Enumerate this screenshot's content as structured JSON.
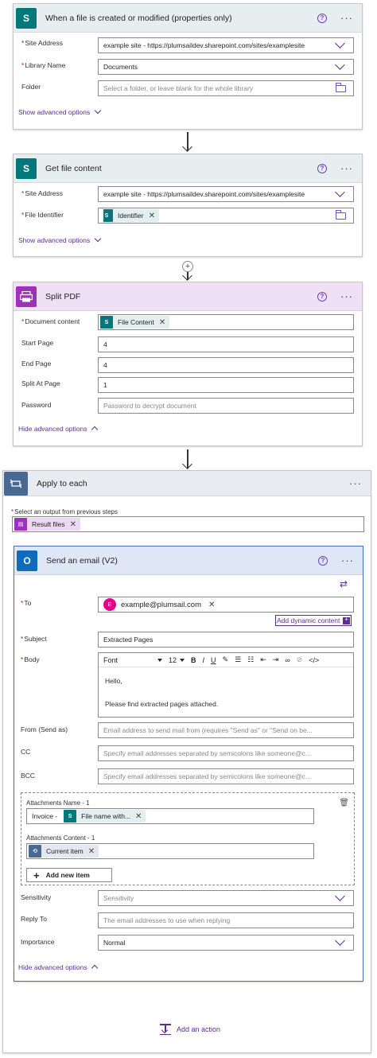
{
  "trigger": {
    "title": "When a file is created or modified (properties only)",
    "icon": "sharepoint-icon",
    "icon_letter": "S",
    "site_address_label": "Site Address",
    "site_address_value": "example site - https://plumsaildev.sharepoint.com/sites/examplesite",
    "library_name_label": "Library Name",
    "library_name_value": "Documents",
    "folder_label": "Folder",
    "folder_placeholder": "Select a folder, or leave blank for the whole library",
    "advanced_link": "Show advanced options"
  },
  "get_file": {
    "title": "Get file content",
    "icon": "sharepoint-icon",
    "icon_letter": "S",
    "site_address_label": "Site Address",
    "site_address_value": "example site - https://plumsaildev.sharepoint.com/sites/examplesite",
    "file_identifier_label": "File Identifier",
    "file_identifier_token": "Identifier",
    "advanced_link": "Show advanced options"
  },
  "split_pdf": {
    "title": "Split PDF",
    "icon": "pdf-icon",
    "document_content_label": "Document content",
    "document_content_token": "File Content",
    "start_page_label": "Start Page",
    "start_page_value": "4",
    "end_page_label": "End Page",
    "end_page_value": "4",
    "split_at_page_label": "Split At Page",
    "split_at_page_value": "1",
    "password_label": "Password",
    "password_placeholder": "Password to decrypt document",
    "advanced_link": "Hide advanced options"
  },
  "apply_each": {
    "title": "Apply to each",
    "icon": "loop-icon",
    "select_label": "Select an output from previous steps",
    "select_token": "Result files"
  },
  "send_email": {
    "title": "Send an email (V2)",
    "icon": "outlook-icon",
    "icon_letter": "O",
    "to_label": "To",
    "to_avatar": "E",
    "to_value": "example@plumsail.com",
    "dynamic_content_label": "Add dynamic content",
    "subject_label": "Subject",
    "subject_value": "Extracted Pages",
    "body_label": "Body",
    "body_font": "Font",
    "body_size": "12",
    "body_line1": "Hello,",
    "body_line2": "Please find extracted pages attached.",
    "from_label": "From (Send as)",
    "from_placeholder": "Email address to send mail from (requires \"Send as\" or \"Send on be...",
    "cc_label": "CC",
    "cc_placeholder": "Specify email addresses separated by semicolons like someone@c...",
    "bcc_label": "BCC",
    "bcc_placeholder": "Specify email addresses separated by semicolons like someone@c...",
    "att_name_label": "Attachments Name - 1",
    "att_name_prefix": "Invoice -",
    "att_name_token": "File name with...",
    "att_content_label": "Attachments Content - 1",
    "att_content_token": "Current item",
    "add_item_label": "Add new item",
    "sensitivity_label": "Sensitivity",
    "sensitivity_placeholder": "Sensitivity",
    "reply_to_label": "Reply To",
    "reply_to_placeholder": "The email addresses to use when replying",
    "importance_label": "Importance",
    "importance_value": "Normal",
    "advanced_link": "Hide advanced options"
  },
  "common": {
    "help_symbol": "?",
    "more_symbol": "···",
    "remove_symbol": "✕",
    "required_mark": "*"
  },
  "footer": {
    "add_action": "Add an action"
  },
  "colors": {
    "accent": "#5c2d91",
    "sharepoint": "#03787c",
    "pdf": "#a02fbf",
    "loop": "#486991",
    "outlook": "#0f6cbd",
    "required": "#a4262c"
  }
}
